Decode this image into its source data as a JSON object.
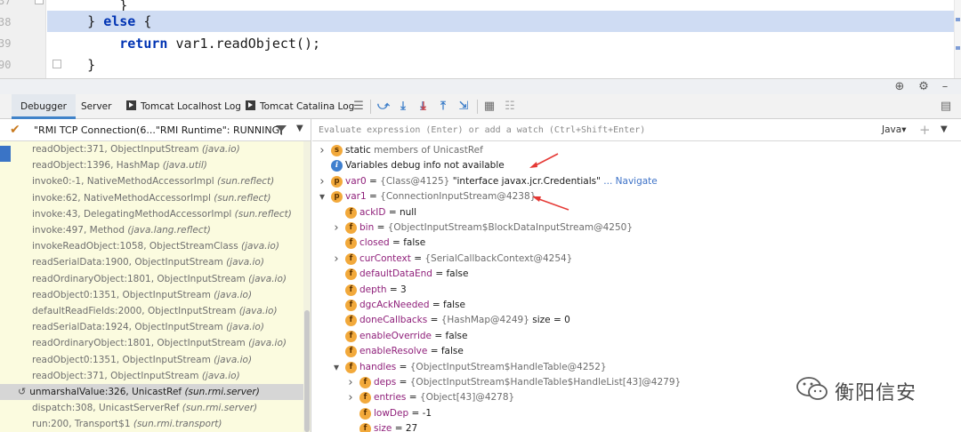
{
  "editor": {
    "line_numbers": [
      "37",
      "38",
      "39",
      "90"
    ],
    "lines": [
      {
        "indent": "        ",
        "parts": [
          {
            "t": "}",
            "kw": false
          }
        ]
      },
      {
        "indent": "    ",
        "parts": [
          {
            "t": "} ",
            "kw": false
          },
          {
            "t": "else",
            "kw": true
          },
          {
            "t": " {",
            "kw": false
          }
        ]
      },
      {
        "indent": "        ",
        "parts": [
          {
            "t": "return",
            "kw": true
          },
          {
            "t": " var1.readObject();",
            "kw": false
          }
        ]
      },
      {
        "indent": "    ",
        "parts": [
          {
            "t": "}",
            "kw": false
          }
        ]
      }
    ]
  },
  "tabs": {
    "debugger": "Debugger",
    "server": "Server",
    "tomcat_localhost": "Tomcat Localhost Log",
    "tomcat_catalina": "Tomcat Catalina Log"
  },
  "thread": {
    "label": "\"RMI TCP Connection(6...\"RMI Runtime\": RUNNING"
  },
  "frames": [
    {
      "method": "readObject:371, ObjectInputStream",
      "pkg": "(java.io)"
    },
    {
      "method": "readObject:1396, HashMap",
      "pkg": "(java.util)"
    },
    {
      "method": "invoke0:-1, NativeMethodAccessorImpl",
      "pkg": "(sun.reflect)"
    },
    {
      "method": "invoke:62, NativeMethodAccessorImpl",
      "pkg": "(sun.reflect)"
    },
    {
      "method": "invoke:43, DelegatingMethodAccessorImpl",
      "pkg": "(sun.reflect)"
    },
    {
      "method": "invoke:497, Method",
      "pkg": "(java.lang.reflect)"
    },
    {
      "method": "invokeReadObject:1058, ObjectStreamClass",
      "pkg": "(java.io)"
    },
    {
      "method": "readSerialData:1900, ObjectInputStream",
      "pkg": "(java.io)"
    },
    {
      "method": "readOrdinaryObject:1801, ObjectInputStream",
      "pkg": "(java.io)"
    },
    {
      "method": "readObject0:1351, ObjectInputStream",
      "pkg": "(java.io)"
    },
    {
      "method": "defaultReadFields:2000, ObjectInputStream",
      "pkg": "(java.io)"
    },
    {
      "method": "readSerialData:1924, ObjectInputStream",
      "pkg": "(java.io)"
    },
    {
      "method": "readOrdinaryObject:1801, ObjectInputStream",
      "pkg": "(java.io)"
    },
    {
      "method": "readObject0:1351, ObjectInputStream",
      "pkg": "(java.io)"
    },
    {
      "method": "readObject:371, ObjectInputStream",
      "pkg": "(java.io)"
    },
    {
      "method": "unmarshalValue:326, UnicastRef",
      "pkg": "(sun.rmi.server)",
      "selected": true
    },
    {
      "method": "dispatch:308, UnicastServerRef",
      "pkg": "(sun.rmi.server)"
    },
    {
      "method": "run:200, Transport$1",
      "pkg": "(sun.rmi.transport)"
    }
  ],
  "eval": {
    "placeholder": "Evaluate expression (Enter) or add a watch (Ctrl+Shift+Enter)",
    "language": "Java"
  },
  "variables": [
    {
      "level": 0,
      "arrow": "right",
      "badge": "s",
      "parts": [
        {
          "c": "vstr",
          "t": "static"
        },
        {
          "c": "vgray",
          "t": " members of UnicastRef"
        }
      ]
    },
    {
      "level": 0,
      "arrow": "",
      "badge": "i",
      "parts": [
        {
          "c": "vstr",
          "t": "Variables debug info not available"
        }
      ]
    },
    {
      "level": 0,
      "arrow": "right",
      "badge": "p",
      "parts": [
        {
          "c": "vname",
          "t": "var0"
        },
        {
          "c": "vstr",
          "t": " = "
        },
        {
          "c": "vgray",
          "t": "{Class@4125} "
        },
        {
          "c": "vstr",
          "t": "\"interface javax.jcr.Credentials\""
        },
        {
          "c": "vlink",
          "t": " ... Navigate"
        }
      ]
    },
    {
      "level": 0,
      "arrow": "down",
      "badge": "p",
      "parts": [
        {
          "c": "vname",
          "t": "var1"
        },
        {
          "c": "vstr",
          "t": " = "
        },
        {
          "c": "vgray",
          "t": "{ConnectionInputStream@4238}"
        }
      ]
    },
    {
      "level": 1,
      "arrow": "",
      "badge": "f",
      "parts": [
        {
          "c": "vname",
          "t": "ackID"
        },
        {
          "c": "vstr",
          "t": " = null"
        }
      ]
    },
    {
      "level": 1,
      "arrow": "right",
      "badge": "f",
      "parts": [
        {
          "c": "vname",
          "t": "bin"
        },
        {
          "c": "vstr",
          "t": " = "
        },
        {
          "c": "vgray",
          "t": "{ObjectInputStream$BlockDataInputStream@4250}"
        }
      ]
    },
    {
      "level": 1,
      "arrow": "",
      "badge": "f",
      "parts": [
        {
          "c": "vname",
          "t": "closed"
        },
        {
          "c": "vstr",
          "t": " = false"
        }
      ]
    },
    {
      "level": 1,
      "arrow": "right",
      "badge": "f",
      "parts": [
        {
          "c": "vname",
          "t": "curContext"
        },
        {
          "c": "vstr",
          "t": " = "
        },
        {
          "c": "vgray",
          "t": "{SerialCallbackContext@4254}"
        }
      ]
    },
    {
      "level": 1,
      "arrow": "",
      "badge": "f",
      "parts": [
        {
          "c": "vname",
          "t": "defaultDataEnd"
        },
        {
          "c": "vstr",
          "t": " = false"
        }
      ]
    },
    {
      "level": 1,
      "arrow": "",
      "badge": "f",
      "parts": [
        {
          "c": "vname",
          "t": "depth"
        },
        {
          "c": "vstr",
          "t": " = 3"
        }
      ]
    },
    {
      "level": 1,
      "arrow": "",
      "badge": "f",
      "parts": [
        {
          "c": "vname",
          "t": "dgcAckNeeded"
        },
        {
          "c": "vstr",
          "t": " = false"
        }
      ]
    },
    {
      "level": 1,
      "arrow": "",
      "badge": "f",
      "parts": [
        {
          "c": "vname",
          "t": "doneCallbacks"
        },
        {
          "c": "vstr",
          "t": " = "
        },
        {
          "c": "vgray",
          "t": "{HashMap@4249} "
        },
        {
          "c": "vstr",
          "t": " size = 0"
        }
      ]
    },
    {
      "level": 1,
      "arrow": "",
      "badge": "f",
      "parts": [
        {
          "c": "vname",
          "t": "enableOverride"
        },
        {
          "c": "vstr",
          "t": " = false"
        }
      ]
    },
    {
      "level": 1,
      "arrow": "",
      "badge": "f",
      "parts": [
        {
          "c": "vname",
          "t": "enableResolve"
        },
        {
          "c": "vstr",
          "t": " = false"
        }
      ]
    },
    {
      "level": 1,
      "arrow": "down",
      "badge": "f",
      "parts": [
        {
          "c": "vname",
          "t": "handles"
        },
        {
          "c": "vstr",
          "t": " = "
        },
        {
          "c": "vgray",
          "t": "{ObjectInputStream$HandleTable@4252}"
        }
      ]
    },
    {
      "level": 2,
      "arrow": "right",
      "badge": "f",
      "parts": [
        {
          "c": "vname",
          "t": "deps"
        },
        {
          "c": "vstr",
          "t": " = "
        },
        {
          "c": "vgray",
          "t": "{ObjectInputStream$HandleTable$HandleList[43]@4279}"
        }
      ]
    },
    {
      "level": 2,
      "arrow": "right",
      "badge": "f",
      "parts": [
        {
          "c": "vname",
          "t": "entries"
        },
        {
          "c": "vstr",
          "t": " = "
        },
        {
          "c": "vgray",
          "t": "{Object[43]@4278}"
        }
      ]
    },
    {
      "level": 2,
      "arrow": "",
      "badge": "f",
      "parts": [
        {
          "c": "vname",
          "t": "lowDep"
        },
        {
          "c": "vstr",
          "t": " = -1"
        }
      ]
    },
    {
      "level": 2,
      "arrow": "",
      "badge": "f",
      "parts": [
        {
          "c": "vname",
          "t": "size"
        },
        {
          "c": "vstr",
          "t": " = 27"
        }
      ]
    }
  ],
  "watermark": {
    "text": "衡阳信安"
  },
  "colors": {
    "keyword": "#0033b3",
    "highlight_line": "#cfdcf3",
    "frames_bg": "#fbfbdf",
    "annotation_arrow": "#e53935",
    "field_badge": "#f2a93b"
  }
}
